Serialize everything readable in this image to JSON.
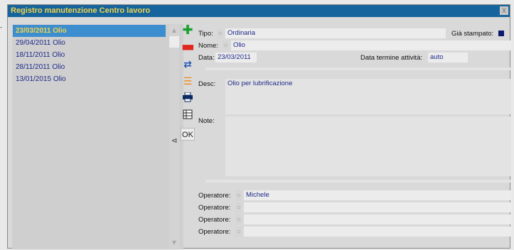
{
  "window": {
    "title": "Registro manutenzione Centro lavoro",
    "close_label": "X"
  },
  "side_marker": "-",
  "list": {
    "items": [
      {
        "label": "23/03/2011 Olio",
        "selected": true
      },
      {
        "label": "29/04/2011 Olio",
        "selected": false
      },
      {
        "label": "18/11/2011 Olio",
        "selected": false
      },
      {
        "label": "28/11/2011 Olio",
        "selected": false
      },
      {
        "label": "13/01/2015 Olio",
        "selected": false
      }
    ],
    "collapse_glyph": "⊲"
  },
  "toolbar": {
    "ok_label": "OK"
  },
  "form": {
    "tipo_label": "Tipo:",
    "tipo_value": "Ordinaria",
    "gia_stampato_label": "Già stampato:",
    "gia_stampato_checked": true,
    "nome_label": "Nome:",
    "nome_value": "Olio",
    "data_label": "Data:",
    "data_value": "23/03/2011",
    "data_termine_label": "Data termine attività:",
    "data_termine_value": "auto",
    "desc_label": "Desc:",
    "desc_value": "Olio per lubrificazione",
    "note_label": "Note:",
    "note_value": "",
    "operatori": [
      {
        "label": "Operatore:",
        "value": "Michele"
      },
      {
        "label": "Operatore:",
        "value": ""
      },
      {
        "label": "Operatore:",
        "value": ""
      },
      {
        "label": "Operatore:",
        "value": ""
      }
    ]
  },
  "colors": {
    "titlebar": "#15649d",
    "title_text": "#f2d24a",
    "selected_row": "#3d8ecf",
    "value_text": "#1f2a8a"
  }
}
